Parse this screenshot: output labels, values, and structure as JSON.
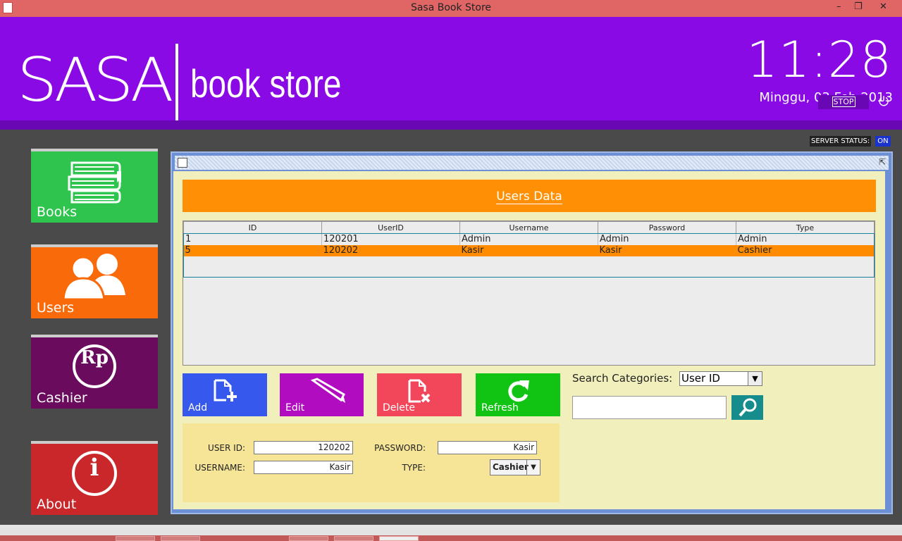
{
  "window": {
    "title": "Sasa Book Store",
    "min": "–",
    "max": "❐",
    "close": "✕"
  },
  "header": {
    "logo_left": "SASA",
    "logo_right": "book store",
    "clock": "11:28",
    "date": "Minggu, 03 Feb 2013",
    "stop_label": "STOP",
    "power": "⏻"
  },
  "server": {
    "label": "SERVER STATUS:",
    "value": "ON"
  },
  "nav": {
    "books": "Books",
    "users": "Users",
    "cashier": "Cashier",
    "about": "About",
    "cashier_icon": "Rp",
    "about_icon": "i"
  },
  "panel": {
    "title": "Users Data"
  },
  "table": {
    "columns": [
      "ID",
      "UserID",
      "Username",
      "Password",
      "Type"
    ],
    "rows": [
      {
        "id": "1",
        "userid": "120201",
        "username": "Admin",
        "password": "Admin",
        "type": "Admin"
      },
      {
        "id": "5",
        "userid": "120202",
        "username": "Kasir",
        "password": "Kasir",
        "type": "Cashier"
      }
    ],
    "selected_row": 1
  },
  "actions": {
    "add": "Add",
    "edit": "Edit",
    "delete": "Delete",
    "refresh": "Refresh"
  },
  "search": {
    "label": "Search Categories:",
    "category": "User ID",
    "query": ""
  },
  "form": {
    "userid_label": "USER ID:",
    "userid": "120202",
    "password_label": "PASSWORD:",
    "password": "Kasir",
    "username_label": "USERNAME:",
    "username": "Kasir",
    "type_label": "TYPE:",
    "type": "Cashier"
  },
  "colors": {
    "header": "#8a0ae6",
    "books": "#2ec44e",
    "users": "#f96a0b",
    "cashier": "#6b0b5e",
    "about": "#c9272a",
    "title_band": "#ff9005"
  }
}
